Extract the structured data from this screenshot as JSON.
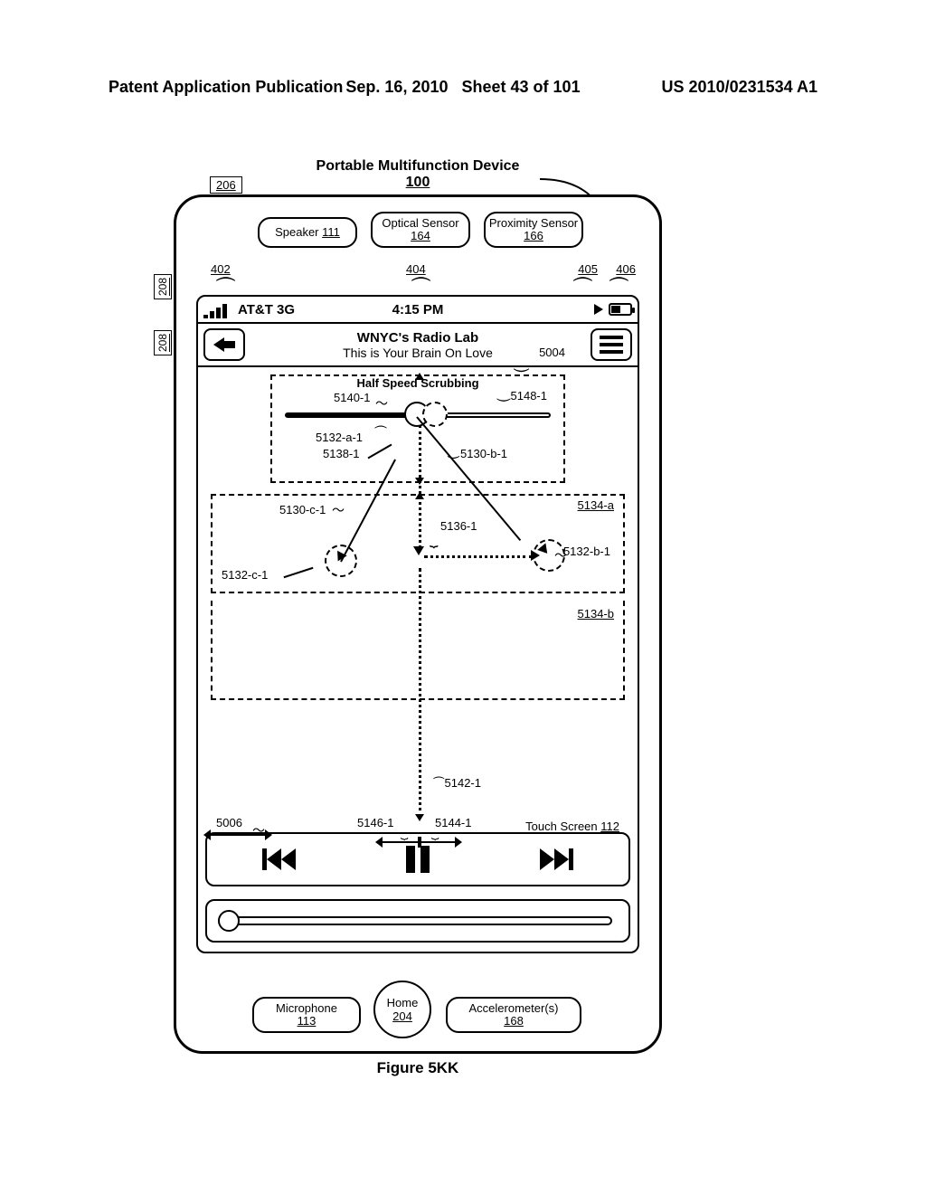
{
  "doc_header": {
    "left": "Patent Application Publication",
    "date": "Sep. 16, 2010",
    "sheet": "Sheet 43 of 101",
    "pubno": "US 2010/0231534 A1"
  },
  "device": {
    "title_line1": "Portable Multifunction Device",
    "title_ref": "100",
    "speaker": "Speaker",
    "speaker_ref": "111",
    "optical": "Optical Sensor",
    "optical_ref": "164",
    "proximity": "Proximity Sensor",
    "proximity_ref": "166",
    "mic": "Microphone",
    "mic_ref": "113",
    "home": "Home",
    "home_ref": "204",
    "accel": "Accelerometer(s)",
    "accel_ref": "168"
  },
  "callouts": {
    "r206": "206",
    "r208": "208",
    "r402": "402",
    "r404": "404",
    "r405": "405",
    "r406": "406"
  },
  "status_bar": {
    "carrier": "AT&T 3G",
    "time": "4:15 PM"
  },
  "title_bar": {
    "line1": "WNYC's Radio Lab",
    "line2": "This is Your Brain On Love",
    "r5004": "5004"
  },
  "scrub": {
    "label": "Half Speed Scrubbing",
    "r5148_1": "5148-1",
    "r5140_1": "5140-1",
    "r5132_a_1": "5132-a-1",
    "r5138_1": "5138-1",
    "r5130_b_1": "5130-b-1",
    "r5130_c_1": "5130-c-1",
    "r5134_a": "5134-a",
    "r5136_1": "5136-1",
    "r5132_b_1": "5132-b-1",
    "r5132_c_1": "5132-c-1",
    "r5134_b": "5134-b",
    "r5142_1": "5142-1",
    "r5146_1": "5146-1",
    "r5144_1": "5144-1",
    "r5006": "5006",
    "touch_screen": "Touch Screen",
    "touch_ref": "112"
  },
  "figure_caption": "Figure 5KK"
}
